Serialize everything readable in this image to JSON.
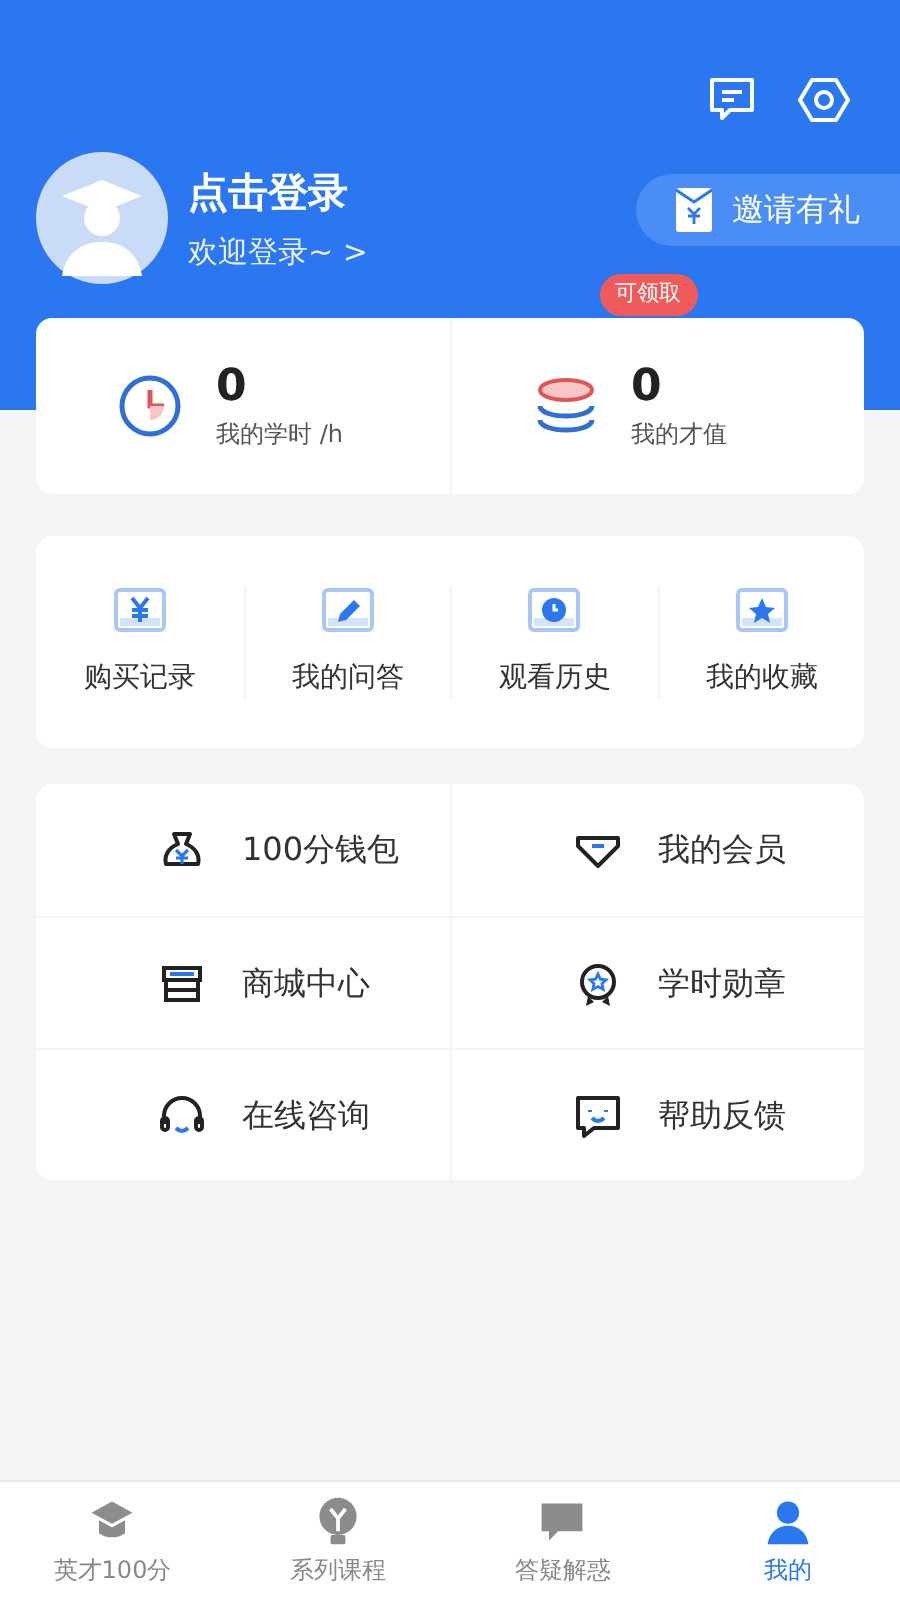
{
  "profile": {
    "name": "点击登录",
    "subtitle": "欢迎登录~",
    "arrow": ">",
    "invite": "邀请有礼"
  },
  "stats": [
    {
      "kind": "clock",
      "value": "0",
      "label": "我的学时 /h"
    },
    {
      "kind": "coins",
      "value": "0",
      "label": "我的才值",
      "badge": "可领取"
    }
  ],
  "shortcuts": [
    {
      "kind": "yen",
      "label": "购买记录"
    },
    {
      "kind": "pencil",
      "label": "我的问答"
    },
    {
      "kind": "clock",
      "label": "观看历史"
    },
    {
      "kind": "star",
      "label": "我的收藏"
    }
  ],
  "menu": [
    {
      "kind": "bag",
      "label": "100分钱包"
    },
    {
      "kind": "diamond",
      "label": "我的会员"
    },
    {
      "kind": "shop",
      "label": "商城中心"
    },
    {
      "kind": "medal",
      "label": "学时勋章"
    },
    {
      "kind": "headset",
      "label": "在线咨询"
    },
    {
      "kind": "feedback",
      "label": "帮助反馈"
    }
  ],
  "tabs": [
    {
      "kind": "cap",
      "label": "英才100分",
      "selected": false
    },
    {
      "kind": "bulb",
      "label": "系列课程",
      "selected": false
    },
    {
      "kind": "qa",
      "label": "答疑解惑",
      "selected": false
    },
    {
      "kind": "user",
      "label": "我的",
      "selected": true
    }
  ]
}
